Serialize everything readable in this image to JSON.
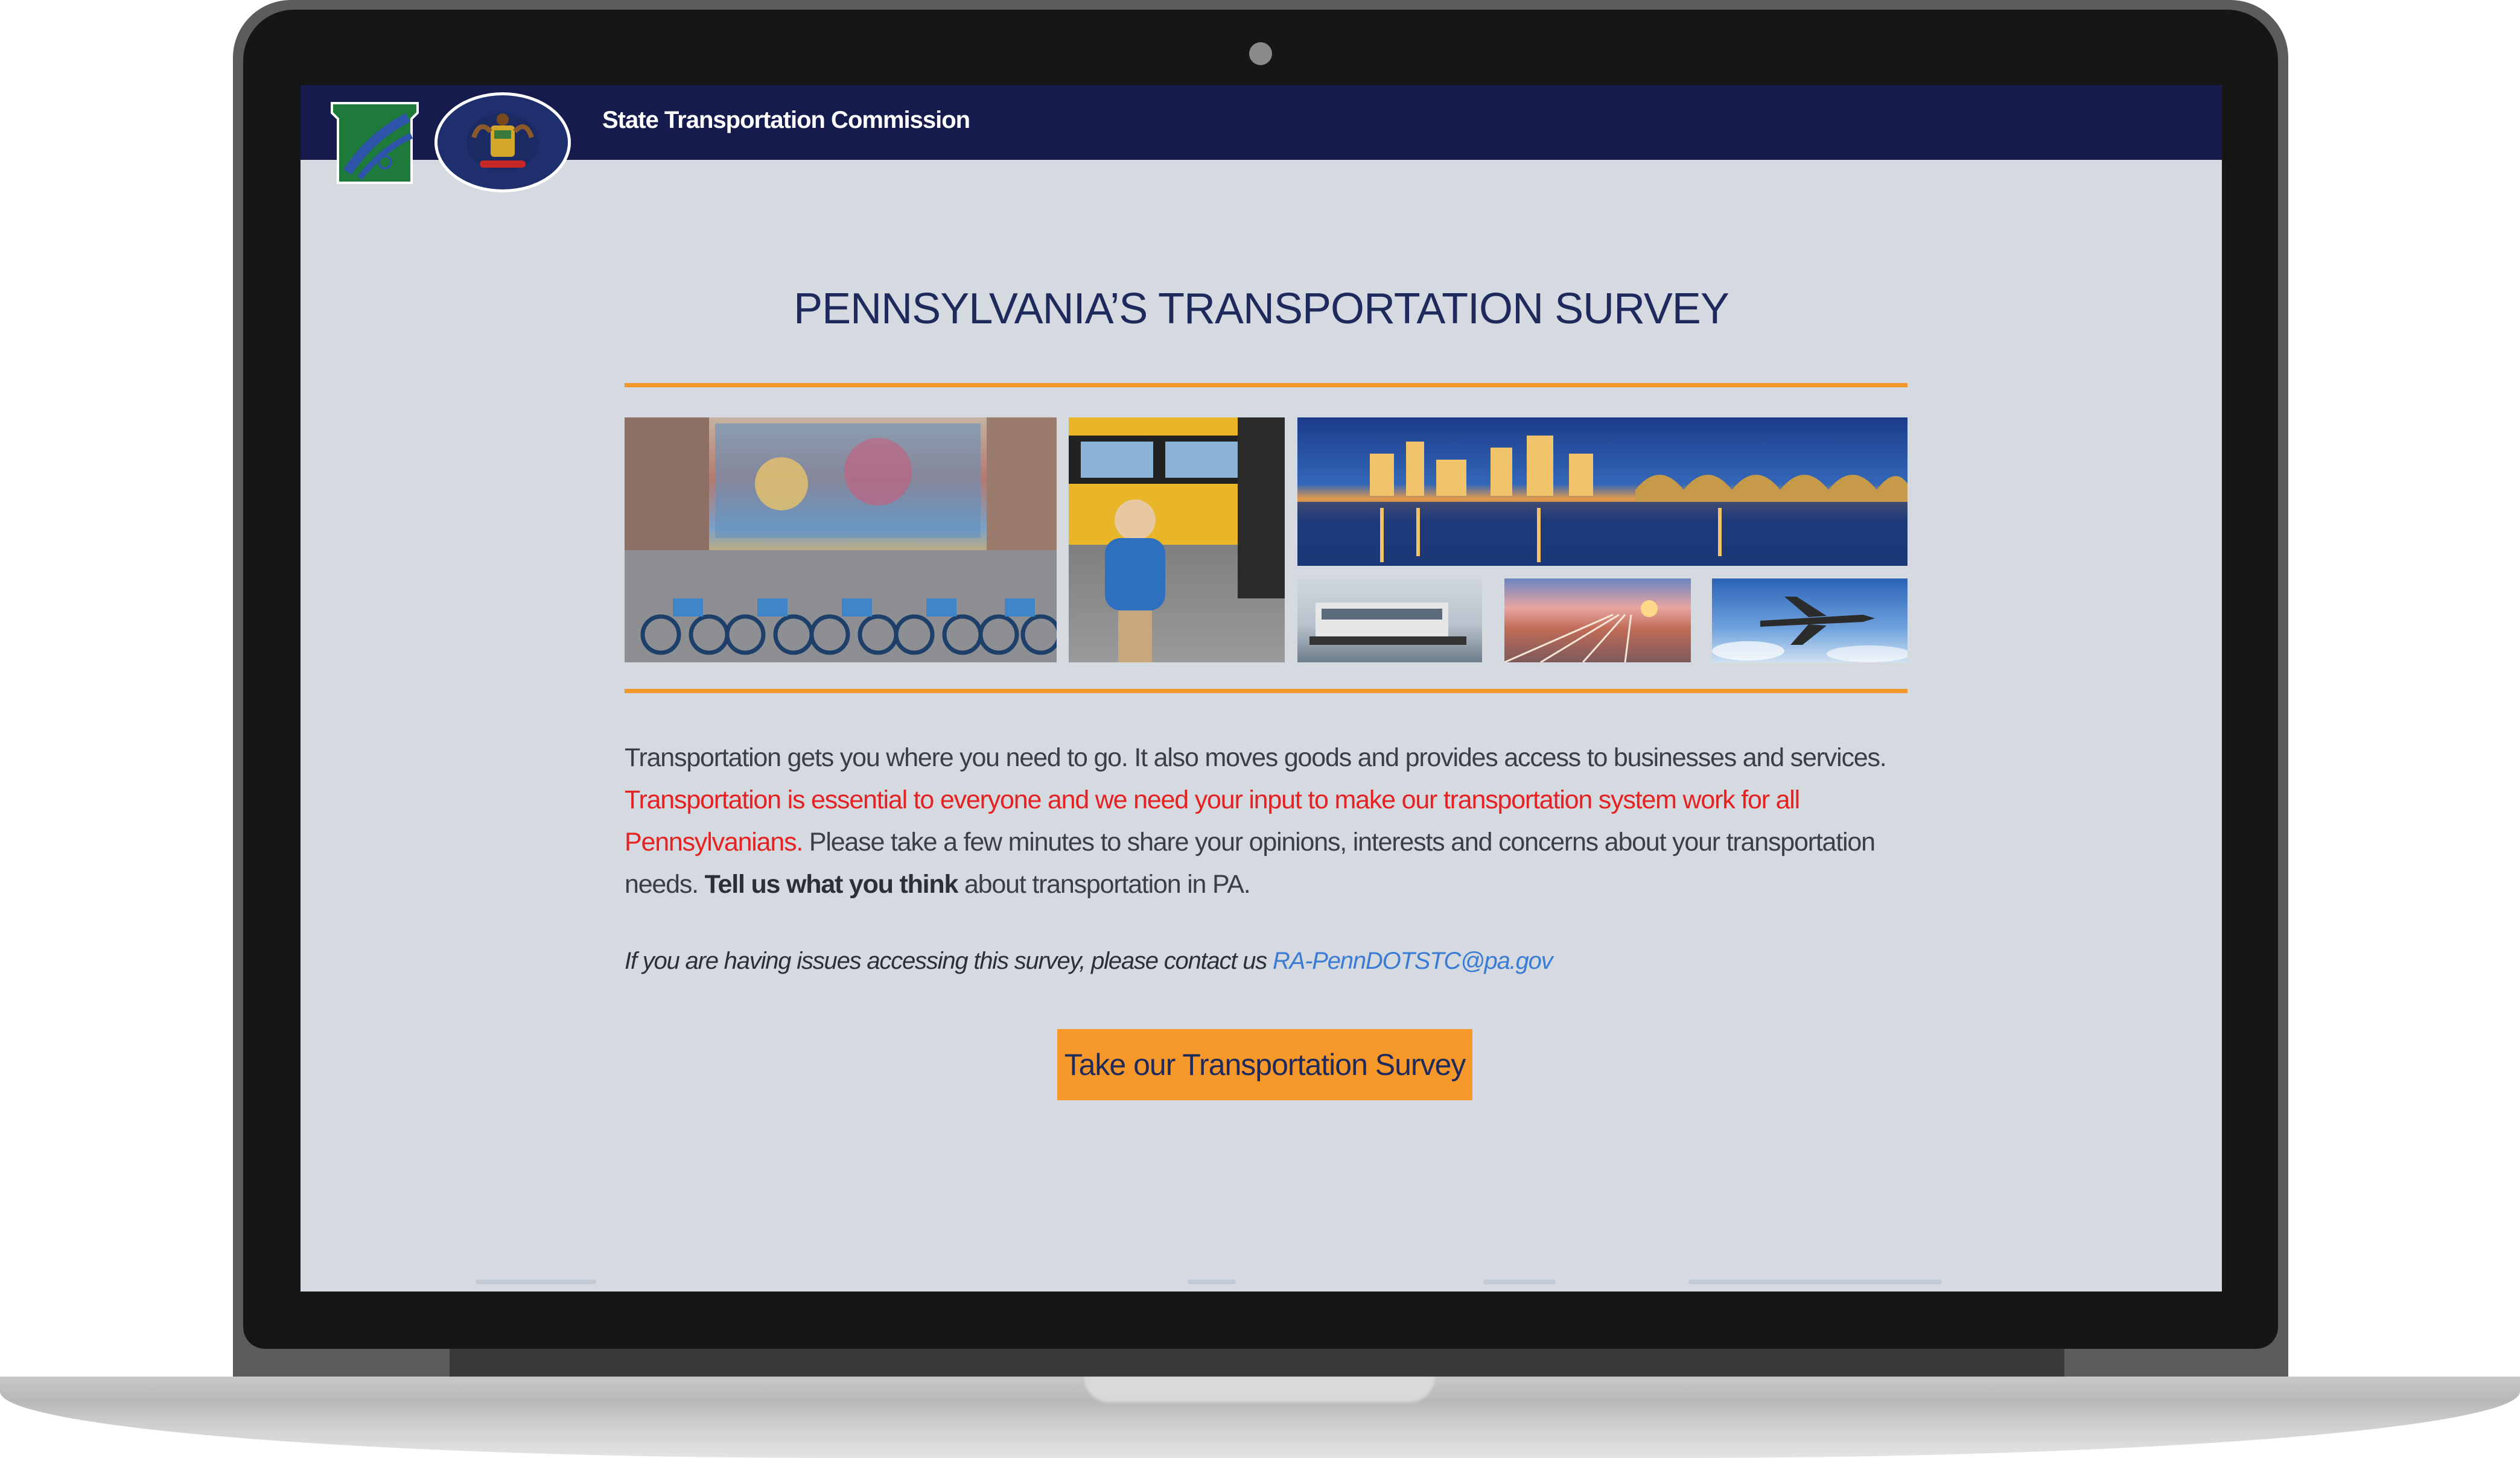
{
  "header": {
    "site_title": "State Transportation Commission",
    "keystone_logo": "pennsylvania-keystone-logo",
    "seal_logo": "pennsylvania-state-seal"
  },
  "main": {
    "title": "PENNSYLVANIA’S TRANSPORTATION SURVEY",
    "images": [
      "bike-share-mural-photo",
      "school-bus-child-photo",
      "harrisburg-skyline-bridge-photo",
      "river-boat-photo",
      "rail-yard-sunset-photo",
      "airplane-sky-photo"
    ],
    "intro_part1": "Transportation gets you where you need to go. It also moves goods and provides access to businesses and services. ",
    "intro_red": "Transportation is essential to everyone and we need your input to make our transportation system work for all Pennsylvanians.",
    "intro_part2": " Please take a few minutes to share your opinions, interests and concerns about your transportation needs. ",
    "intro_bold": "Tell us what you think",
    "intro_part3": " about transportation in PA.",
    "contact_prefix": "If you are having issues accessing this survey, please contact us ",
    "contact_email": "RA-PennDOTSTC@pa.gov",
    "survey_button": "Take our Transportation Survey"
  },
  "colors": {
    "header_bg": "#161b4d",
    "page_bg": "#d5dae0",
    "accent_orange": "#f6992a",
    "title_navy": "#1f2a5c",
    "emphasis_red": "#e52121",
    "link_blue": "#3a7bd5"
  }
}
